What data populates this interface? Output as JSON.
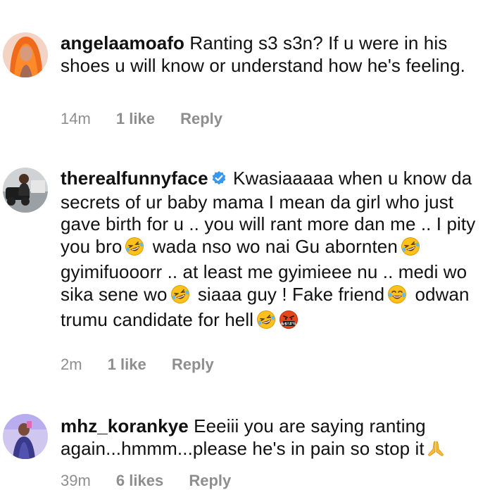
{
  "comments": [
    {
      "username": "angelaamoafo",
      "verified": false,
      "text": "Ranting s3 s3n? If u were in his shoes u will know or understand how he's feeling.",
      "time": "14m",
      "likes": "1 like",
      "reply": "Reply"
    },
    {
      "username": "therealfunnyface",
      "verified": true,
      "text_parts": [
        "Kwasiaaaaa when u know da secrets of ur baby mama I mean da girl who just gave birth for u .. you will rant more dan me .. I pity you bro",
        "wada nso wo nai Gu abornten",
        "gyimifuooorr .. at least me gyimieee nu .. medi wo sika sene wo",
        "siaaa guy ! Fake friend",
        "odwan trumu candidate for hell"
      ],
      "emojis": [
        "rolling-on-floor-laughing",
        "rolling-on-floor-laughing",
        "rolling-on-floor-laughing",
        "face-with-tears-of-joy",
        "rolling-on-floor-laughing",
        "face-with-symbols-on-mouth"
      ],
      "time": "2m",
      "likes": "1 like",
      "reply": "Reply"
    },
    {
      "username": "mhz_korankye",
      "verified": false,
      "text": "Eeeiii you are saying ranting again...hmmm...please he's in pain so stop it",
      "emojis": [
        "folded-hands"
      ],
      "time": "39m",
      "likes": "6 likes",
      "reply": "Reply"
    }
  ],
  "colors": {
    "text": "#111111",
    "meta": "#8e8e8e",
    "verified": "#3897f0",
    "background": "#ffffff"
  }
}
